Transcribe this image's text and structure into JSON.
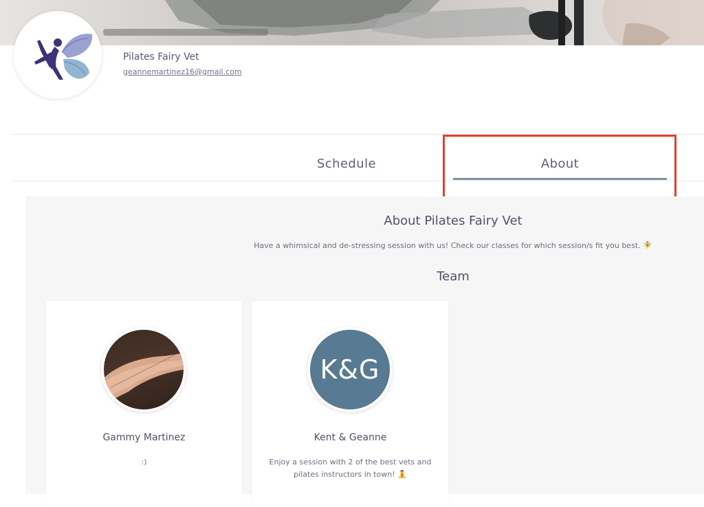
{
  "profile": {
    "business_name": "Pilates Fairy Vet",
    "email": "geannemartinez16@gmail.com"
  },
  "tabs": [
    {
      "label": "Schedule",
      "active": false
    },
    {
      "label": "About",
      "active": true
    }
  ],
  "about": {
    "title": "About Pilates Fairy Vet",
    "description": "Have a whimsical and de-stressing session with us! Check our classes for which session/s fit you best. 🧚",
    "team_heading": "Team"
  },
  "team": [
    {
      "name": "Gammy Martinez",
      "bio": ":)",
      "avatar": "photo"
    },
    {
      "name": "Kent & Geanne",
      "bio": "Enjoy a session with 2 of the best vets and pilates instructors in town! 🧘",
      "initials": "K&G"
    }
  ],
  "colors": {
    "highlight": "#e43f2a",
    "tab_underline": "#7d8e9b",
    "initials_avatar_bg": "#587a93",
    "panel_bg": "#f6f6f6"
  }
}
